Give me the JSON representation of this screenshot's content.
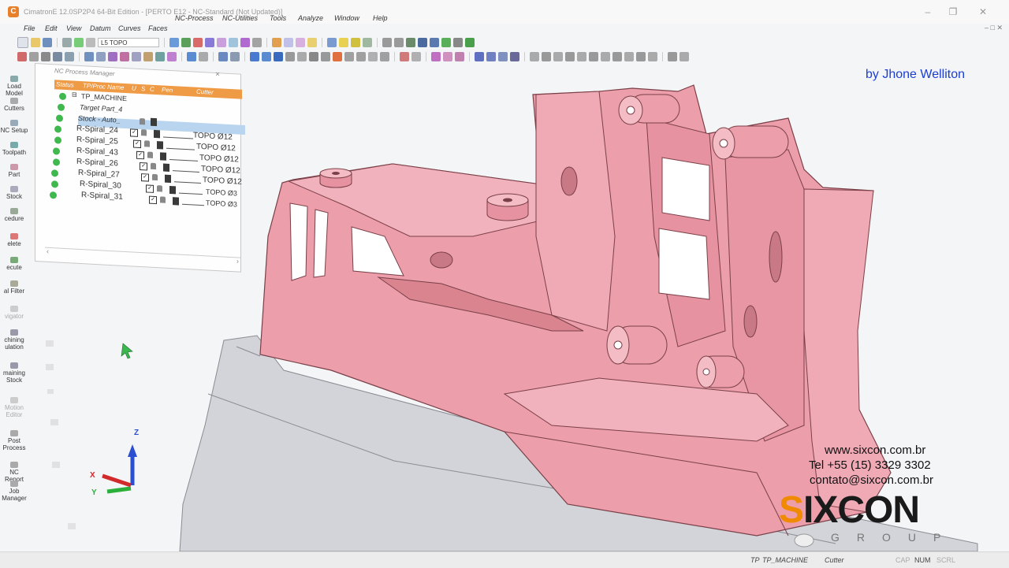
{
  "titlebar": {
    "title": "CimatronE 12.0SP2P4  64-Bit Edition - [PERTO E12 - NC-Standard (Not Updated)]",
    "icon": "cimatron-logo-icon",
    "minimize": "–",
    "restore": "❐",
    "close": "✕"
  },
  "menu": {
    "items": [
      "File",
      "Edit",
      "View",
      "Datum",
      "Curves",
      "Faces",
      "NC-Process",
      "NC-Utilities",
      "Tools",
      "Analyze",
      "Window",
      "Help"
    ]
  },
  "toolbar": {
    "layer_select": "L5 TOPO"
  },
  "mini_controls": "– □ ✕",
  "left_bar": {
    "items": [
      {
        "label": "Load Model",
        "icon": "load-model-icon"
      },
      {
        "label": "Cutters",
        "icon": "cutters-icon"
      },
      {
        "label": "NC Setup",
        "icon": "nc-setup-icon"
      },
      {
        "label": "Toolpath",
        "icon": "toolpath-icon"
      },
      {
        "label": "Part",
        "icon": "part-icon"
      },
      {
        "label": "Stock",
        "icon": "stock-icon"
      },
      {
        "label": "cedure",
        "icon": "procedure-icon"
      },
      {
        "label": "elete",
        "icon": "delete-icon"
      },
      {
        "label": "ecute",
        "icon": "execute-icon"
      },
      {
        "label": "al Filter",
        "icon": "filter-icon"
      },
      {
        "label": "vigator",
        "icon": "navigator-icon"
      },
      {
        "label": "chining\nulation",
        "icon": "simulation-icon"
      },
      {
        "label": "maining\nStock",
        "icon": "remaining-stock-icon"
      },
      {
        "label": "Motion\nEditor",
        "icon": "motion-editor-icon"
      },
      {
        "label": "Post\nProcess",
        "icon": "post-process-icon"
      },
      {
        "label": "NC Report",
        "icon": "nc-report-icon"
      },
      {
        "label": "Job\nManager",
        "icon": "job-manager-icon"
      }
    ]
  },
  "nc_process_manager": {
    "title": "NC Process Manager",
    "columns": [
      "Status",
      "TP/Proc Name",
      "U",
      "S",
      "C",
      "Pen",
      "Cutter"
    ],
    "root": "TP_MACHINE",
    "rows": [
      {
        "name": "Target Part_4"
      },
      {
        "name": "Stock - Auto_",
        "selected": true
      },
      {
        "name": "R-Spiral_24",
        "cutter": "TOPO Ø12"
      },
      {
        "name": "R-Spiral_25",
        "cutter": "TOPO Ø12"
      },
      {
        "name": "R-Spiral_43",
        "cutter": "TOPO Ø12"
      },
      {
        "name": "R-Spiral_26",
        "cutter": "TOPO Ø12"
      },
      {
        "name": "R-Spiral_27",
        "cutter": "TOPO Ø12"
      },
      {
        "name": "R-Spiral_30",
        "cutter": "TOPO Ø3"
      },
      {
        "name": "R-Spiral_31",
        "cutter": "TOPO Ø3"
      }
    ]
  },
  "overlay": {
    "credit": "by Jhone Welliton",
    "website": "www.sixcon.com.br",
    "phone": "Tel +55 (15) 3329 3302",
    "email": "contato@sixcon.com.br",
    "logo_s": "S",
    "logo_rest": "IXCON",
    "logo_group": "GROUP"
  },
  "axes": {
    "x": "X",
    "y": "Y",
    "z": "Z"
  },
  "colors": {
    "part": "#ec9eab",
    "part_edge": "#7a4048",
    "stock": "#d2d4d9",
    "accent": "#f08a00",
    "status_ok": "#3fb84e",
    "header": "#ef9a45"
  },
  "statusbar": {
    "tp": "TP",
    "machine": "TP_MACHINE",
    "cutter": "Cutter",
    "cap": "CAP",
    "num": "NUM",
    "scrl": "SCRL"
  }
}
